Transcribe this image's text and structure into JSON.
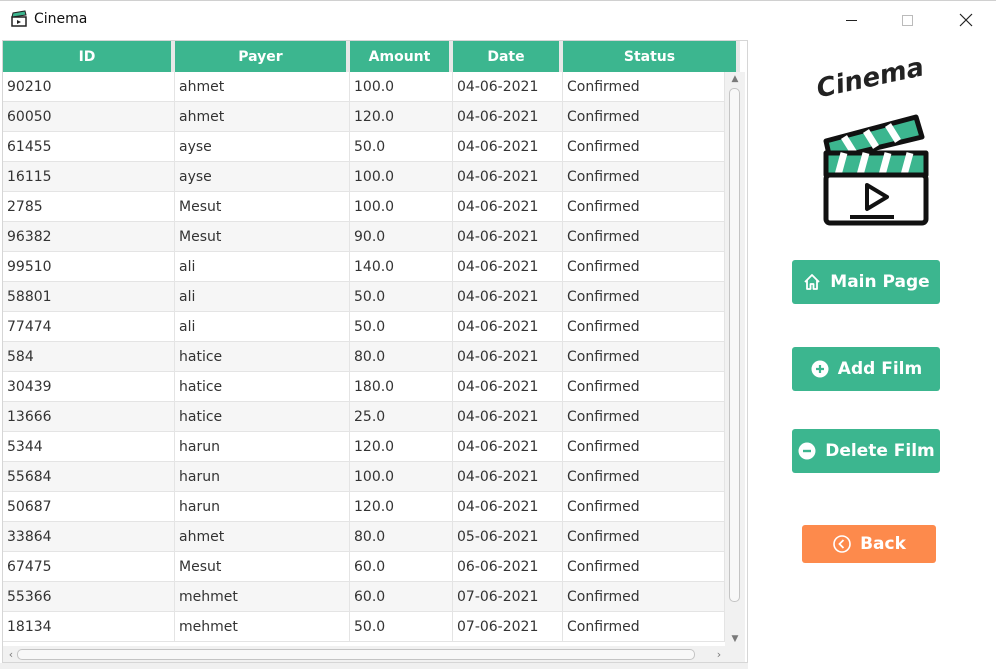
{
  "window": {
    "title": "Cinema"
  },
  "table": {
    "columns": [
      "ID",
      "Payer",
      "Amount",
      "Date",
      "Status"
    ],
    "rows": [
      [
        "90210",
        "ahmet",
        "100.0",
        "04-06-2021",
        "Confirmed"
      ],
      [
        "60050",
        "ahmet",
        "120.0",
        "04-06-2021",
        "Confirmed"
      ],
      [
        "61455",
        "ayse",
        "50.0",
        "04-06-2021",
        "Confirmed"
      ],
      [
        "16115",
        "ayse",
        "100.0",
        "04-06-2021",
        "Confirmed"
      ],
      [
        "2785",
        "Mesut",
        "100.0",
        "04-06-2021",
        "Confirmed"
      ],
      [
        "96382",
        "Mesut",
        "90.0",
        "04-06-2021",
        "Confirmed"
      ],
      [
        "99510",
        "ali",
        "140.0",
        "04-06-2021",
        "Confirmed"
      ],
      [
        "58801",
        "ali",
        "50.0",
        "04-06-2021",
        "Confirmed"
      ],
      [
        "77474",
        "ali",
        "50.0",
        "04-06-2021",
        "Confirmed"
      ],
      [
        "584",
        "hatice",
        "80.0",
        "04-06-2021",
        "Confirmed"
      ],
      [
        "30439",
        "hatice",
        "180.0",
        "04-06-2021",
        "Confirmed"
      ],
      [
        "13666",
        "hatice",
        "25.0",
        "04-06-2021",
        "Confirmed"
      ],
      [
        "5344",
        "harun",
        "120.0",
        "04-06-2021",
        "Confirmed"
      ],
      [
        "55684",
        "harun",
        "100.0",
        "04-06-2021",
        "Confirmed"
      ],
      [
        "50687",
        "harun",
        "120.0",
        "04-06-2021",
        "Confirmed"
      ],
      [
        "33864",
        "ahmet",
        "80.0",
        "05-06-2021",
        "Confirmed"
      ],
      [
        "67475",
        "Mesut",
        "60.0",
        "06-06-2021",
        "Confirmed"
      ],
      [
        "55366",
        "mehmet",
        "60.0",
        "07-06-2021",
        "Confirmed"
      ],
      [
        "18134",
        "mehmet",
        "50.0",
        "07-06-2021",
        "Confirmed"
      ]
    ]
  },
  "logo": {
    "text": "Cinema"
  },
  "sidebar": {
    "main_page_label": "Main Page",
    "add_film_label": "Add Film",
    "delete_film_label": "Delete Film",
    "back_label": "Back"
  },
  "colors": {
    "accent": "#3cb68f",
    "back": "#fd8a4c"
  },
  "icons": {
    "app": "clapperboard-icon",
    "main_page": "home-icon",
    "add_film": "plus-circle-icon",
    "delete_film": "minus-circle-icon",
    "back": "chevron-left-circle-icon"
  }
}
